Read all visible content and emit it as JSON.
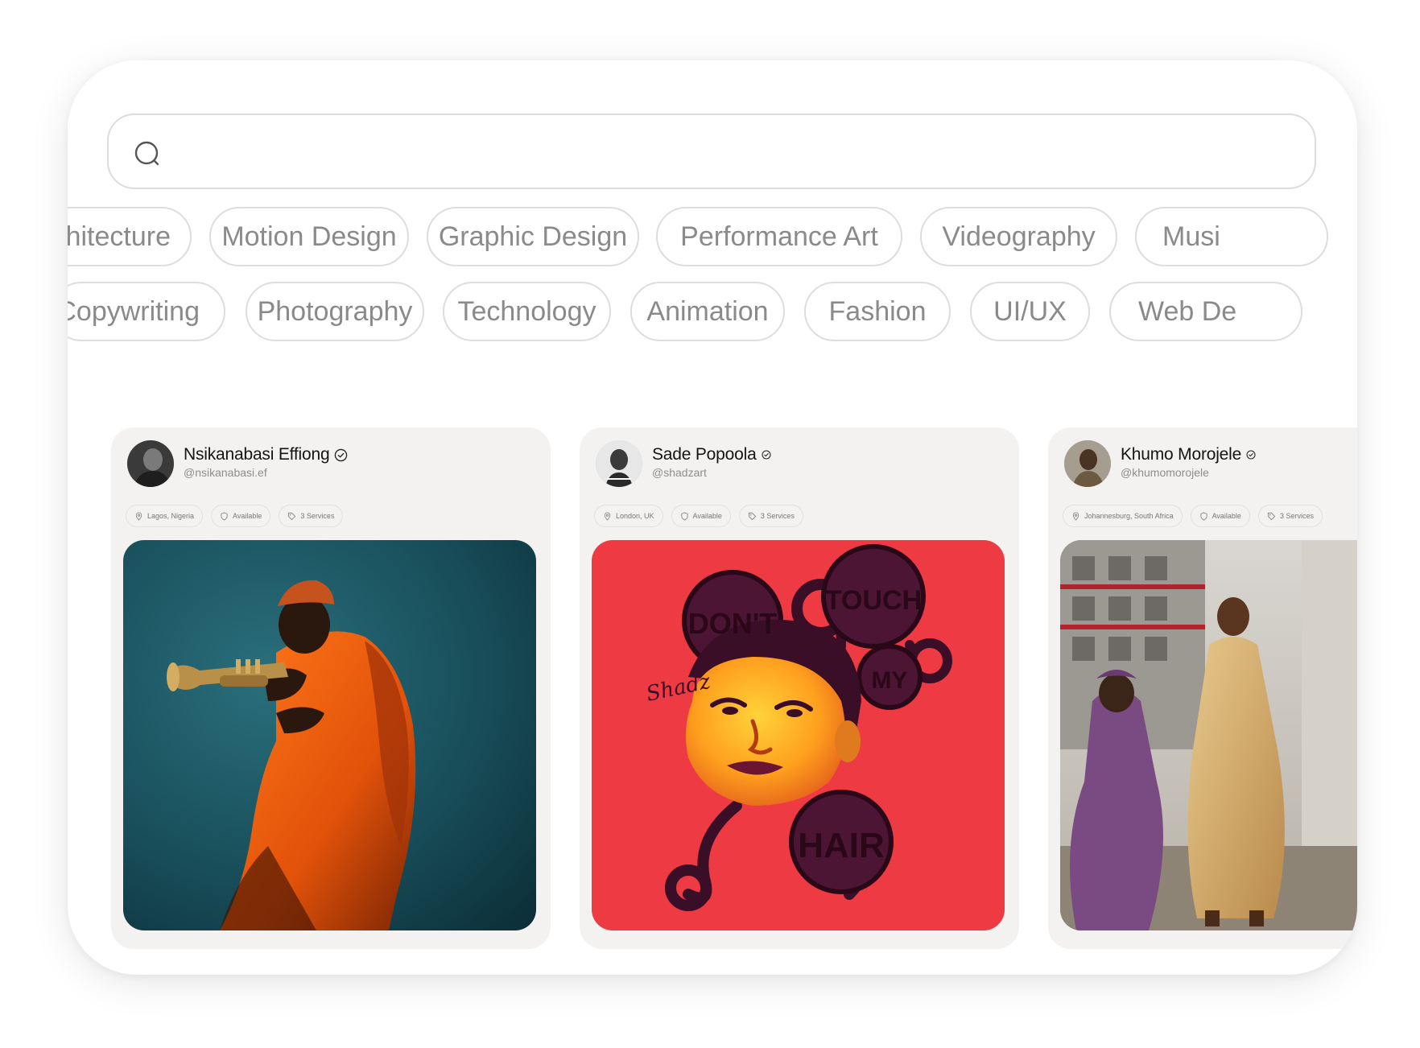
{
  "search": {
    "placeholder": "",
    "value": ""
  },
  "categories_row1": [
    "chitecture",
    "Motion Design",
    "Graphic Design",
    "Performance Art",
    "Videography",
    "Musi"
  ],
  "categories_row2": [
    "Copywriting",
    "Photography",
    "Technology",
    "Animation",
    "Fashion",
    "UI/UX",
    "Web De"
  ],
  "creators": [
    {
      "name": "Nsikanabasi Effiong",
      "handle": "@nsikanabasi.ef",
      "location": "Lagos, Nigeria",
      "availability": "Available",
      "services": "3 Services",
      "artwork_icon": "trumpet-player-photo"
    },
    {
      "name": "Sade Popoola",
      "handle": "@shadzart",
      "location": "London, UK",
      "availability": "Available",
      "services": "3 Services",
      "artwork_icon": "dont-touch-my-hair-illustration",
      "artwork_text": [
        "DON'T",
        "TOUCH",
        "MY",
        "HAIR",
        "Shadz"
      ]
    },
    {
      "name": "Khumo Morojele",
      "handle": "@khumomorojele",
      "location": "Johannesburg, South Africa",
      "availability": "Available",
      "services": "3 Services",
      "artwork_icon": "street-fashion-photo"
    }
  ],
  "colors": {
    "chip_border": "#dddddd",
    "chip_text": "#8a8a8a",
    "card_bg": "#f3f2f0",
    "art_red": "#ee3b43",
    "art_teal": "#1c5563"
  }
}
